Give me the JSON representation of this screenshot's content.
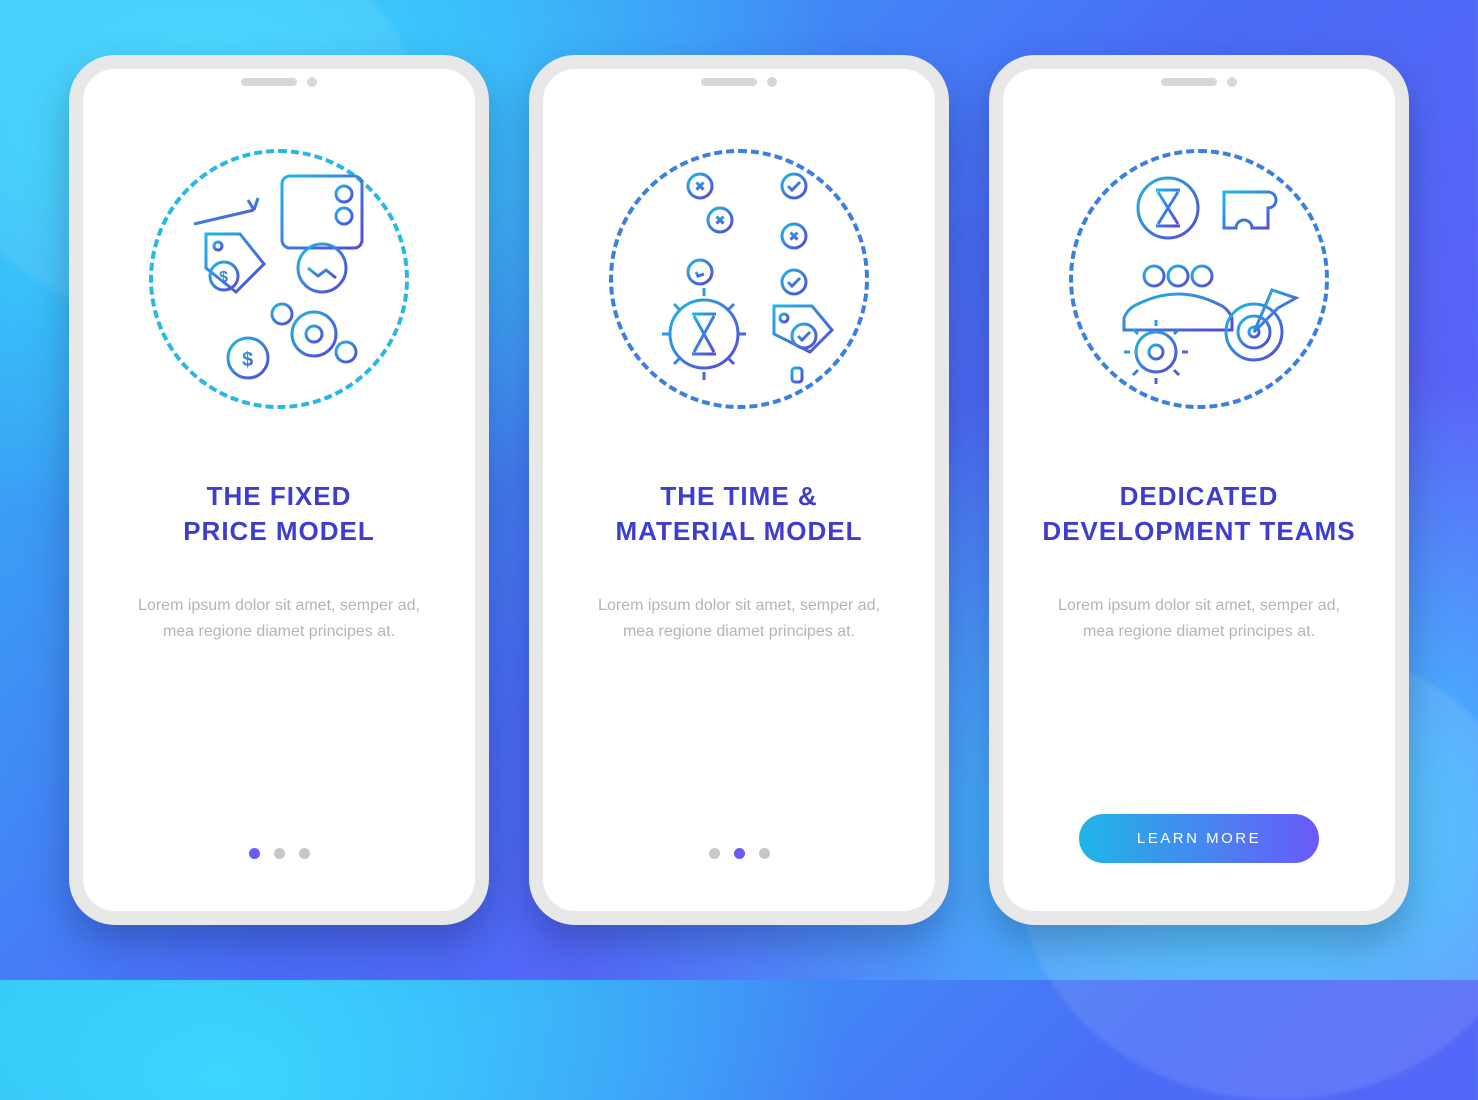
{
  "screens": [
    {
      "title_line1": "THE FIXED",
      "title_line2": "PRICE MODEL",
      "description": "Lorem ipsum dolor sit amet, semper ad, mea regione diamet principes at.",
      "active_dot_index": 0,
      "icon_name": "fixed-price-illustration"
    },
    {
      "title_line1": "THE TIME &",
      "title_line2": "MATERIAL MODEL",
      "description": "Lorem ipsum dolor sit amet, semper ad, mea regione diamet principes at.",
      "active_dot_index": 1,
      "icon_name": "time-material-illustration"
    },
    {
      "title_line1": "DEDICATED",
      "title_line2": "DEVELOPMENT TEAMS",
      "description": "Lorem ipsum dolor sit amet, semper ad, mea regione diamet principes at.",
      "icon_name": "dedicated-teams-illustration",
      "cta_label": "LEARN MORE"
    }
  ],
  "colors": {
    "title": "#3f3dcf",
    "accent_gradient_start": "#1fb6e6",
    "accent_gradient_end": "#6a5af9",
    "placeholder_text": "#b4b4b4"
  }
}
